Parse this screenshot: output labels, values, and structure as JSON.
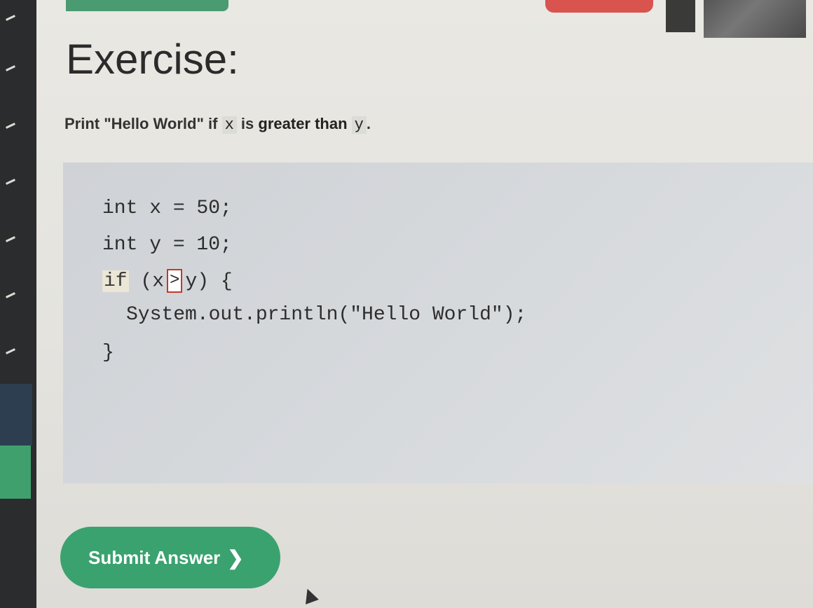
{
  "exercise": {
    "title": "Exercise:",
    "instruction": {
      "prefix": "Print \"Hello World\" if",
      "var_x": "x",
      "middle": "is",
      "strong": "greater than",
      "var_y": "y",
      "suffix": "."
    }
  },
  "code": {
    "line1": "int x = 50;",
    "line2": "int y = 10;",
    "line3_kw": "if",
    "line3_before": " (x",
    "line3_answer": ">",
    "line3_after": "y) {",
    "line4": "System.out.println(\"Hello World\");",
    "line5": "}"
  },
  "submit": {
    "label": "Submit Answer",
    "chevron": "❯"
  },
  "colors": {
    "submit_bg": "#3aa26f",
    "answer_border": "#c0392b",
    "code_bg": "#d6d9dc"
  }
}
